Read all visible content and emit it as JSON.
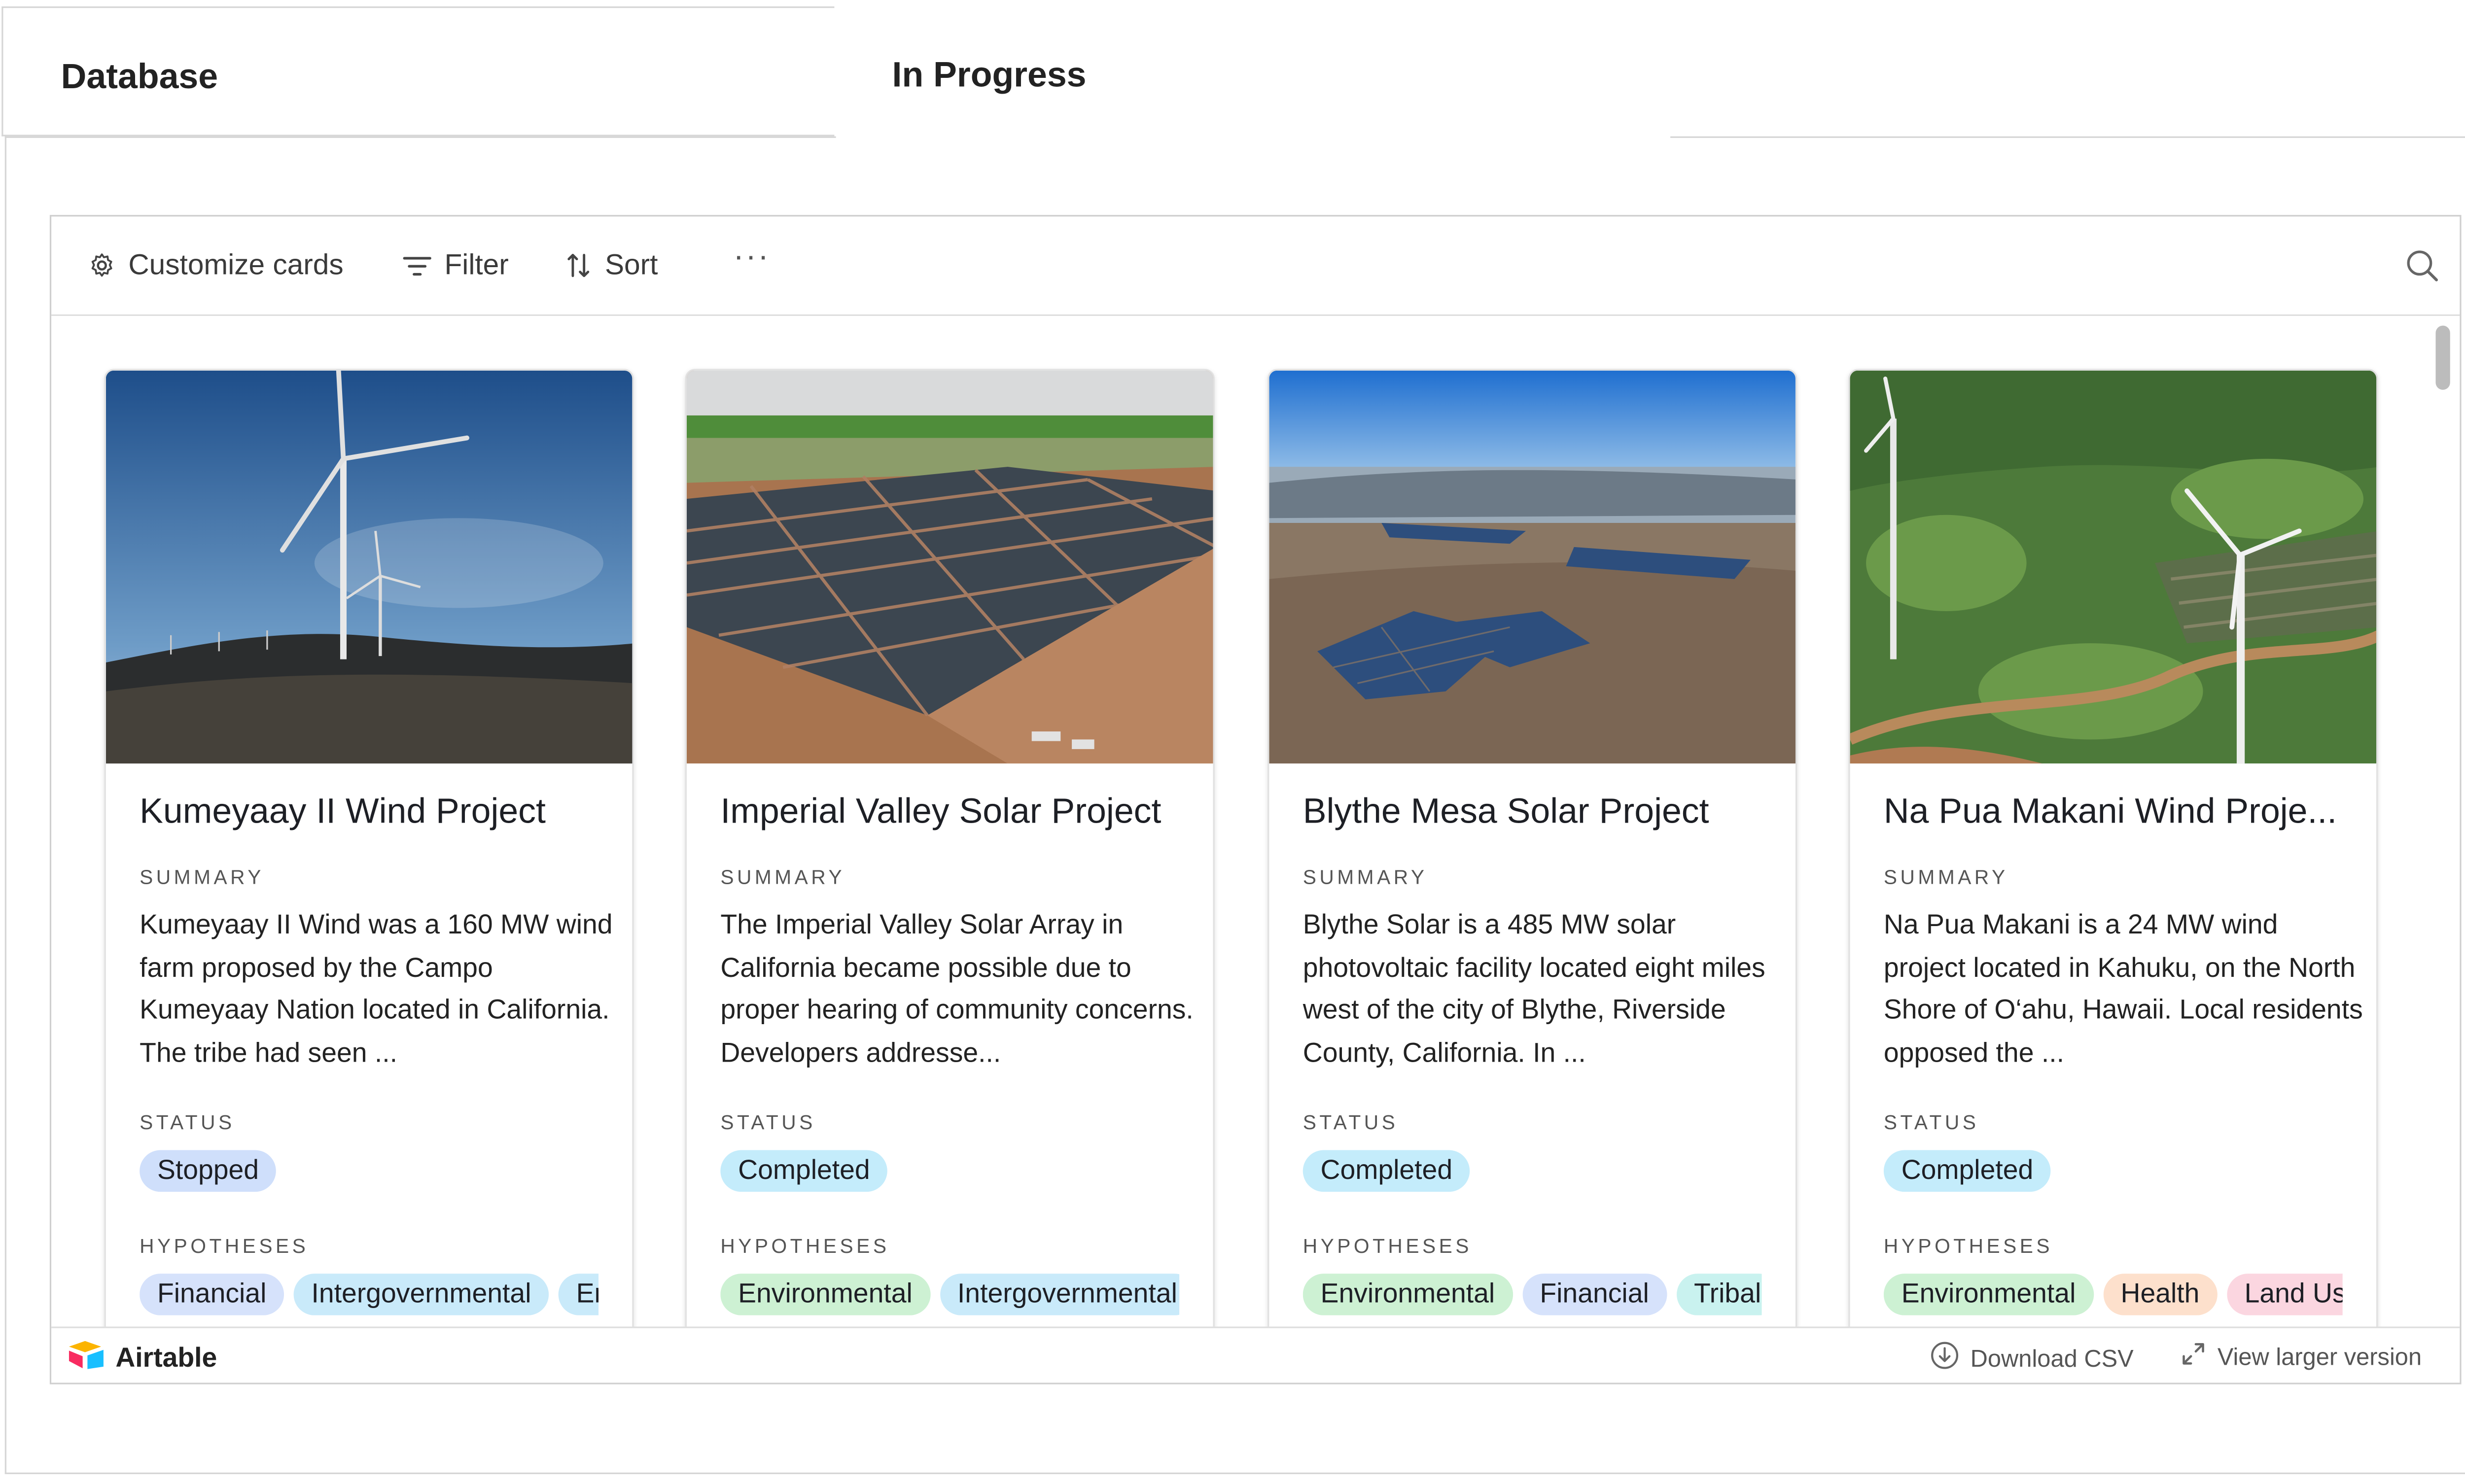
{
  "tabs": [
    {
      "label": "Database"
    },
    {
      "label": "In Progress"
    }
  ],
  "toolbar": {
    "customize_label": "Customize cards",
    "filter_label": "Filter",
    "sort_label": "Sort",
    "more_label": "···"
  },
  "field_labels": {
    "summary": "SUMMARY",
    "status": "STATUS",
    "hypotheses": "HYPOTHESES"
  },
  "cards": [
    {
      "title": "Kumeyaay II Wind Project",
      "summary": "Kumeyaay II Wind was a 160 MW wind farm proposed by the Campo Kumeyaay Nation located in California. The tribe had seen ...",
      "status": "Stopped",
      "hypotheses": [
        "Financial",
        "Intergovernmental",
        "Environmental"
      ]
    },
    {
      "title": "Imperial Valley Solar Project",
      "summary": "The Imperial Valley Solar Array in California became possible due to proper hearing of community concerns. Developers addresse...",
      "status": "Completed",
      "hypotheses": [
        "Environmental",
        "Intergovernmental"
      ]
    },
    {
      "title": "Blythe Mesa Solar Project",
      "summary": "Blythe Solar is a 485 MW solar photovoltaic facility located eight miles west of the city of Blythe, Riverside County, California. In ...",
      "status": "Completed",
      "hypotheses": [
        "Environmental",
        "Financial",
        "Tribal"
      ]
    },
    {
      "title": "Na Pua Makani Wind Proje...",
      "summary": "Na Pua Makani is a 24 MW wind project located in Kahuku, on the North Shore of O‘ahu, Hawaii. Local residents opposed the ...",
      "status": "Completed",
      "hypotheses": [
        "Environmental",
        "Health",
        "Land Use"
      ]
    }
  ],
  "footer": {
    "brand": "Airtable",
    "download_label": "Download CSV",
    "view_label": "View larger version"
  },
  "colors": {
    "status_stopped": "#cfdffb",
    "status_completed": "#c4ecfb",
    "tag_financial": "#d6e2fb",
    "tag_intergovernmental": "#c9eafa",
    "tag_environmental": "#cdf1d3",
    "tag_tribal": "#c9f2ef",
    "tag_health": "#fde0cc",
    "tag_land": "#fbd6e0"
  }
}
